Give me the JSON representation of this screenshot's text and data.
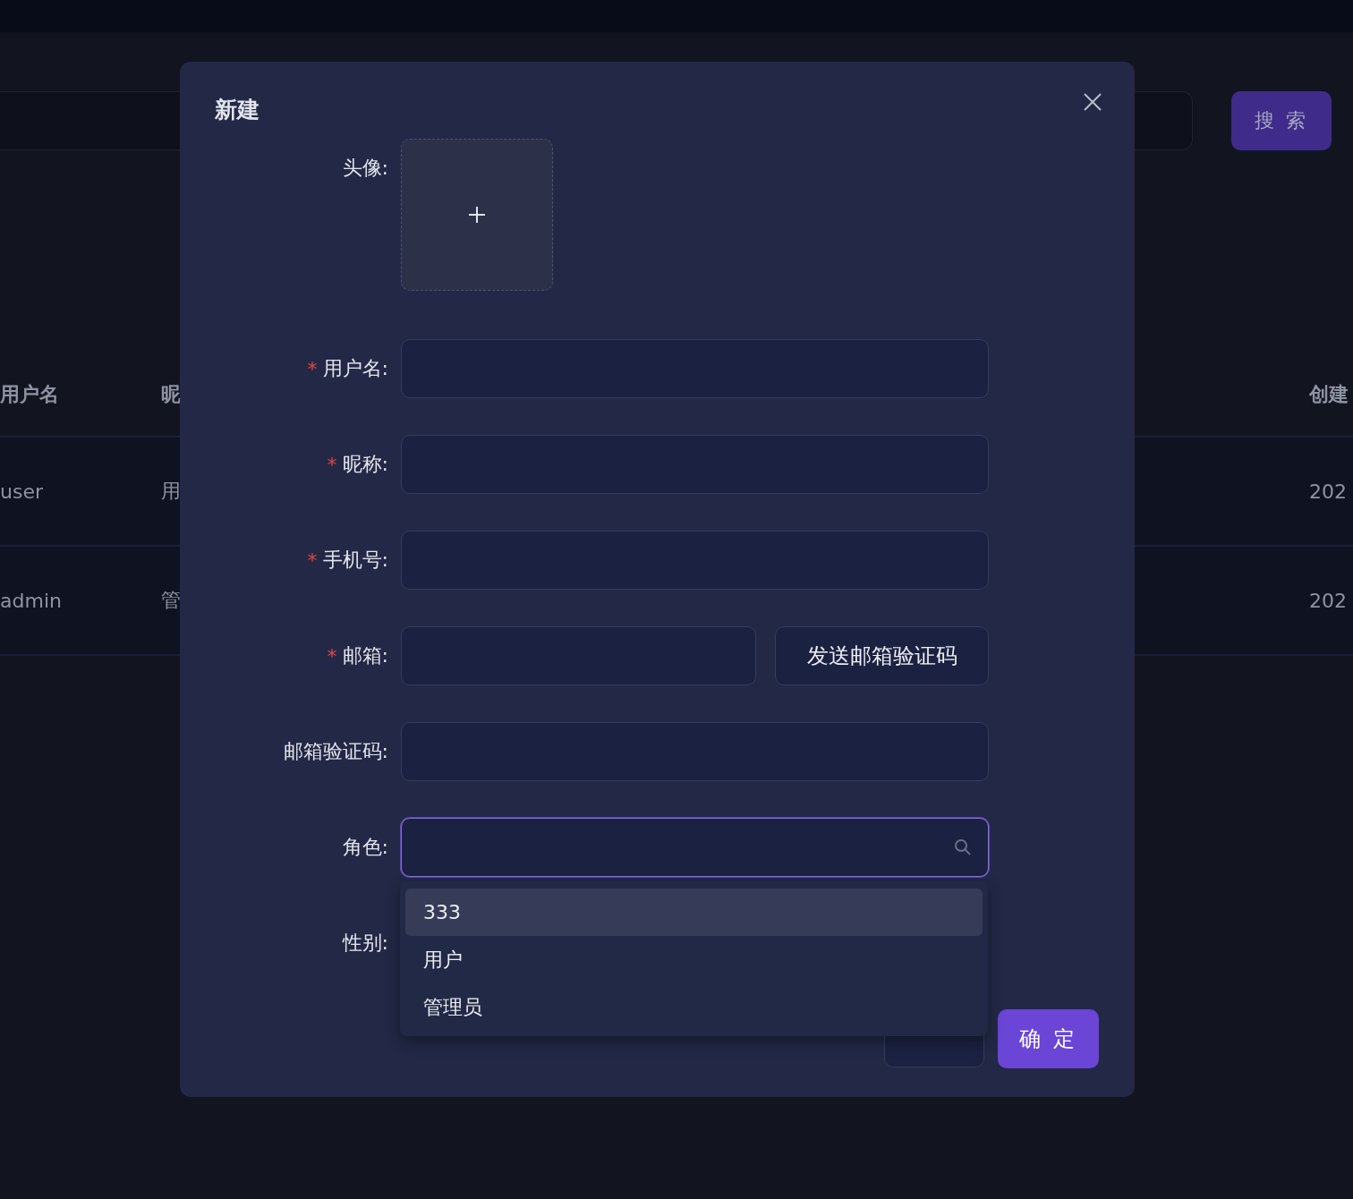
{
  "background": {
    "search_button": "搜 索",
    "table": {
      "columns": [
        "用户名",
        "昵",
        "创建"
      ],
      "rows": [
        [
          "user",
          "用",
          "202"
        ],
        [
          "admin",
          "管",
          "202"
        ]
      ]
    }
  },
  "modal": {
    "title": "新建",
    "fields": [
      {
        "kind": "upload",
        "label": "头像:"
      },
      {
        "kind": "text",
        "label": "用户名:",
        "marker": "*"
      },
      {
        "kind": "text",
        "label": "昵称:",
        "marker": "*"
      },
      {
        "kind": "text",
        "label": "手机号:",
        "marker": "*"
      },
      {
        "kind": "email",
        "label": "邮箱:",
        "marker": "*",
        "button": "发送邮箱验证码"
      },
      {
        "kind": "text",
        "label": "邮箱验证码:"
      },
      {
        "kind": "select",
        "label": "角色:",
        "focused": true
      },
      {
        "kind": "covered",
        "label": "性别:"
      }
    ],
    "dropdown": {
      "options": [
        {
          "label": "333",
          "selected": true
        },
        {
          "label": "用户",
          "selected": false
        },
        {
          "label": "管理员",
          "selected": false
        }
      ]
    },
    "footer": {
      "ok": "确 定"
    }
  }
}
